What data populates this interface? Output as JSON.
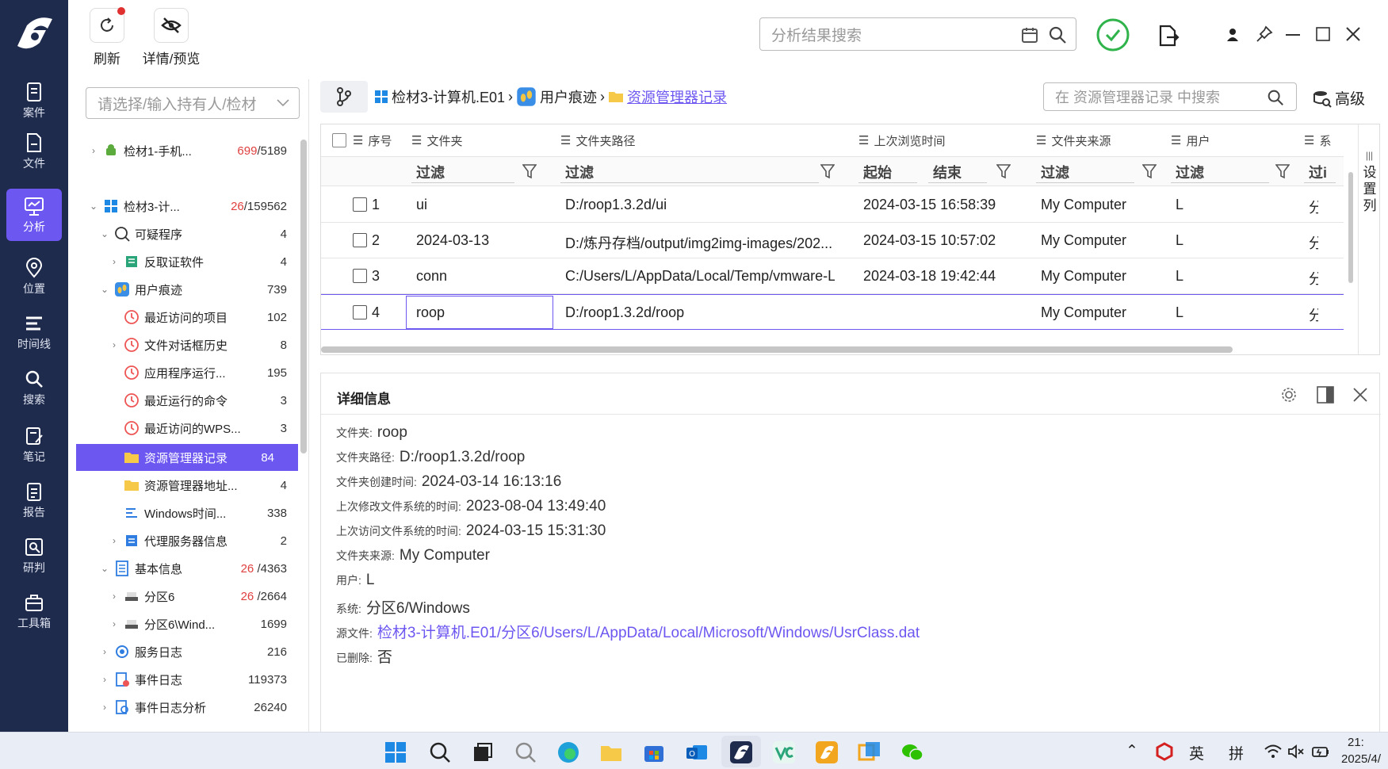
{
  "colors": {
    "rail_bg": "#1f2b4d",
    "accent": "#6c57f0",
    "red_count": "#e04040",
    "link": "#6c57f0"
  },
  "rail": {
    "items": [
      {
        "label": "案件",
        "icon": "case-icon"
      },
      {
        "label": "文件",
        "icon": "file-icon"
      },
      {
        "label": "分析",
        "icon": "analysis-icon",
        "active": true
      },
      {
        "label": "位置",
        "icon": "location-icon"
      },
      {
        "label": "时间线",
        "icon": "timeline-icon"
      },
      {
        "label": "搜索",
        "icon": "search-icon"
      },
      {
        "label": "笔记",
        "icon": "notes-icon"
      },
      {
        "label": "报告",
        "icon": "report-icon"
      },
      {
        "label": "研判",
        "icon": "judge-icon"
      },
      {
        "label": "工具箱",
        "icon": "toolbox-icon"
      }
    ]
  },
  "toolbar": {
    "refresh_label": "刷新",
    "detail_label": "详情/预览"
  },
  "top_search": {
    "placeholder": "分析结果搜索"
  },
  "owner_select": {
    "placeholder": "请选择/输入持有人/检材"
  },
  "breadcrumb": {
    "items": [
      "检材3-计算机.E01",
      "用户痕迹",
      "资源管理器记录"
    ],
    "sep": "›"
  },
  "grid_search": {
    "placeholder": "在 资源管理器记录 中搜索",
    "advanced_label": "高级"
  },
  "tree": {
    "nodes": [
      {
        "label": "检材1-手机...",
        "count_red": "699",
        "count": "/5189"
      },
      {
        "label": "检材3-计...",
        "count_red": "26",
        "count": "/159562"
      },
      {
        "label": "可疑程序",
        "count": "4"
      },
      {
        "label": "反取证软件",
        "count": "4"
      },
      {
        "label": "用户痕迹",
        "count": "739"
      },
      {
        "label": "最近访问的项目",
        "count": "102"
      },
      {
        "label": "文件对话框历史",
        "count": "8"
      },
      {
        "label": "应用程序运行...",
        "count": "195"
      },
      {
        "label": "最近运行的命令",
        "count": "3"
      },
      {
        "label": "最近访问的WPS...",
        "count": "3"
      },
      {
        "label": "资源管理器记录",
        "count": "84"
      },
      {
        "label": "资源管理器地址...",
        "count": "4"
      },
      {
        "label": "Windows时间...",
        "count": "338"
      },
      {
        "label": "代理服务器信息",
        "count": "2"
      },
      {
        "label": "基本信息",
        "count_red": "26",
        "count": "/4363"
      },
      {
        "label": "分区6",
        "count_red": "26",
        "count": "/2664"
      },
      {
        "label": "分区6\\Wind...",
        "count": "1699"
      },
      {
        "label": "服务日志",
        "count": "216"
      },
      {
        "label": "事件日志",
        "count": "119373"
      },
      {
        "label": "事件日志分析",
        "count": "26240"
      }
    ]
  },
  "grid": {
    "columns": [
      "序号",
      "文件夹",
      "文件夹路径",
      "上次浏览时间",
      "文件夹来源",
      "用户",
      "系"
    ],
    "filters": {
      "filter": "过滤",
      "start": "起始",
      "end": "结束",
      "partial": "过i"
    },
    "side_label": "设置列",
    "rows": [
      {
        "n": "1",
        "folder": "ui",
        "path": "D:/roop1.3.2d/ui",
        "time": "2024-03-15 16:58:39",
        "source": "My Computer",
        "user": "L",
        "sys": "分"
      },
      {
        "n": "2",
        "folder": "2024-03-13",
        "path": "D:/炼丹存档/output/img2img-images/202...",
        "time": "2024-03-15 10:57:02",
        "source": "My Computer",
        "user": "L",
        "sys": "分"
      },
      {
        "n": "3",
        "folder": "conn",
        "path": "C:/Users/L/AppData/Local/Temp/vmware-L...",
        "time": "2024-03-18 19:42:44",
        "source": "My Computer",
        "user": "L",
        "sys": "分"
      },
      {
        "n": "4",
        "folder": "roop",
        "path": "D:/roop1.3.2d/roop",
        "time": "",
        "source": "My Computer",
        "user": "L",
        "sys": "分"
      }
    ]
  },
  "details": {
    "title": "详细信息",
    "fields": [
      {
        "k": "文件夹:",
        "v": "roop"
      },
      {
        "k": "文件夹路径:",
        "v": "D:/roop1.3.2d/roop"
      },
      {
        "k": "文件夹创建时间:",
        "v": "2024-03-14 16:13:16"
      },
      {
        "k": "上次修改文件系统的时间:",
        "v": "2023-08-04 13:49:40"
      },
      {
        "k": "上次访问文件系统的时间:",
        "v": "2024-03-15 15:31:30"
      },
      {
        "k": "文件夹来源:",
        "v": "My Computer"
      },
      {
        "k": "用户:",
        "v": "L"
      },
      {
        "k": "系统:",
        "v": "分区6/Windows"
      },
      {
        "k": "源文件:",
        "v": "检材3-计算机.E01/分区6/Users/L/AppData/Local/Microsoft/Windows/UsrClass.dat"
      },
      {
        "k": "已删除:",
        "v": "否"
      }
    ]
  },
  "taskbar": {
    "ime1": "英",
    "ime2": "拼",
    "time": "21:",
    "date": "2025/4/"
  }
}
